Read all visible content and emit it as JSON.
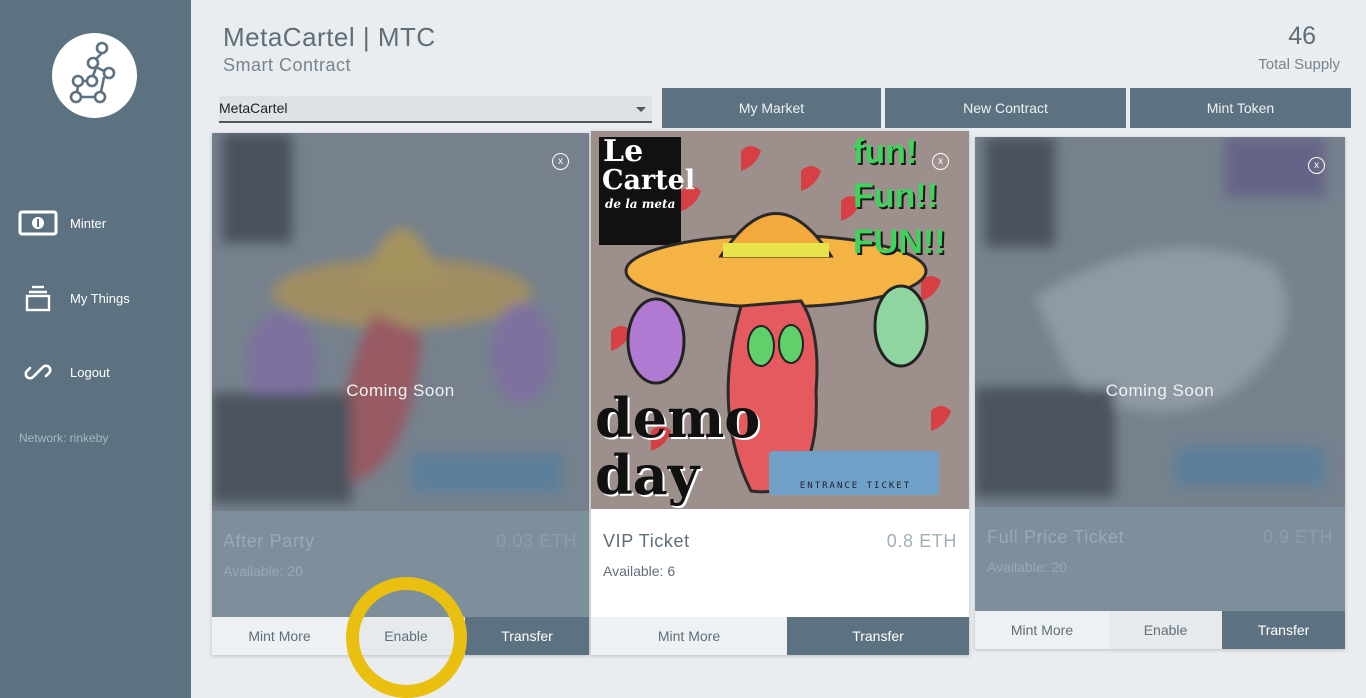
{
  "sidebar": {
    "items": [
      {
        "label": "Minter",
        "icon": "banknote-icon"
      },
      {
        "label": "My Things",
        "icon": "stack-icon"
      },
      {
        "label": "Logout",
        "icon": "link-icon"
      }
    ],
    "network": "Network: rinkeby"
  },
  "header": {
    "title": "MetaCartel | MTC",
    "subtitle": "Smart Contract",
    "supply_value": "46",
    "supply_label": "Total Supply"
  },
  "controls": {
    "contract_select": "MetaCartel",
    "my_market": "My Market",
    "new_contract": "New Contract",
    "mint_token": "Mint Token"
  },
  "cards": [
    {
      "name": "After Party",
      "price": "0.03 ETH",
      "available": "Available: 20",
      "overlay": "Coming Soon",
      "btn1": "Mint More",
      "btn2": "Enable",
      "btn3": "Transfer",
      "close": "x"
    },
    {
      "name": "VIP Ticket",
      "price": "0.8 ETH",
      "available": "Available: 6",
      "btn1": "Mint More",
      "btn3": "Transfer",
      "close": "x",
      "art": {
        "brand_top": "Le",
        "brand_mid": "Cartel",
        "brand_sub": "de la meta",
        "fun1": "fun!",
        "fun2": "Fun!!",
        "fun3": "FUN!!",
        "demo": "demo",
        "day": "day",
        "ticket": "ENTRANCE TICKET"
      }
    },
    {
      "name": "Full Price Ticket",
      "price": "0.9 ETH",
      "available": "Available: 20",
      "overlay": "Coming Soon",
      "btn1": "Mint More",
      "btn2": "Enable",
      "btn3": "Transfer",
      "close": "x"
    }
  ],
  "colors": {
    "sidebar": "#5d7281",
    "background": "#e9edf0",
    "highlight_ring": "#e9bf10",
    "pepper_red": "#d8464b"
  }
}
